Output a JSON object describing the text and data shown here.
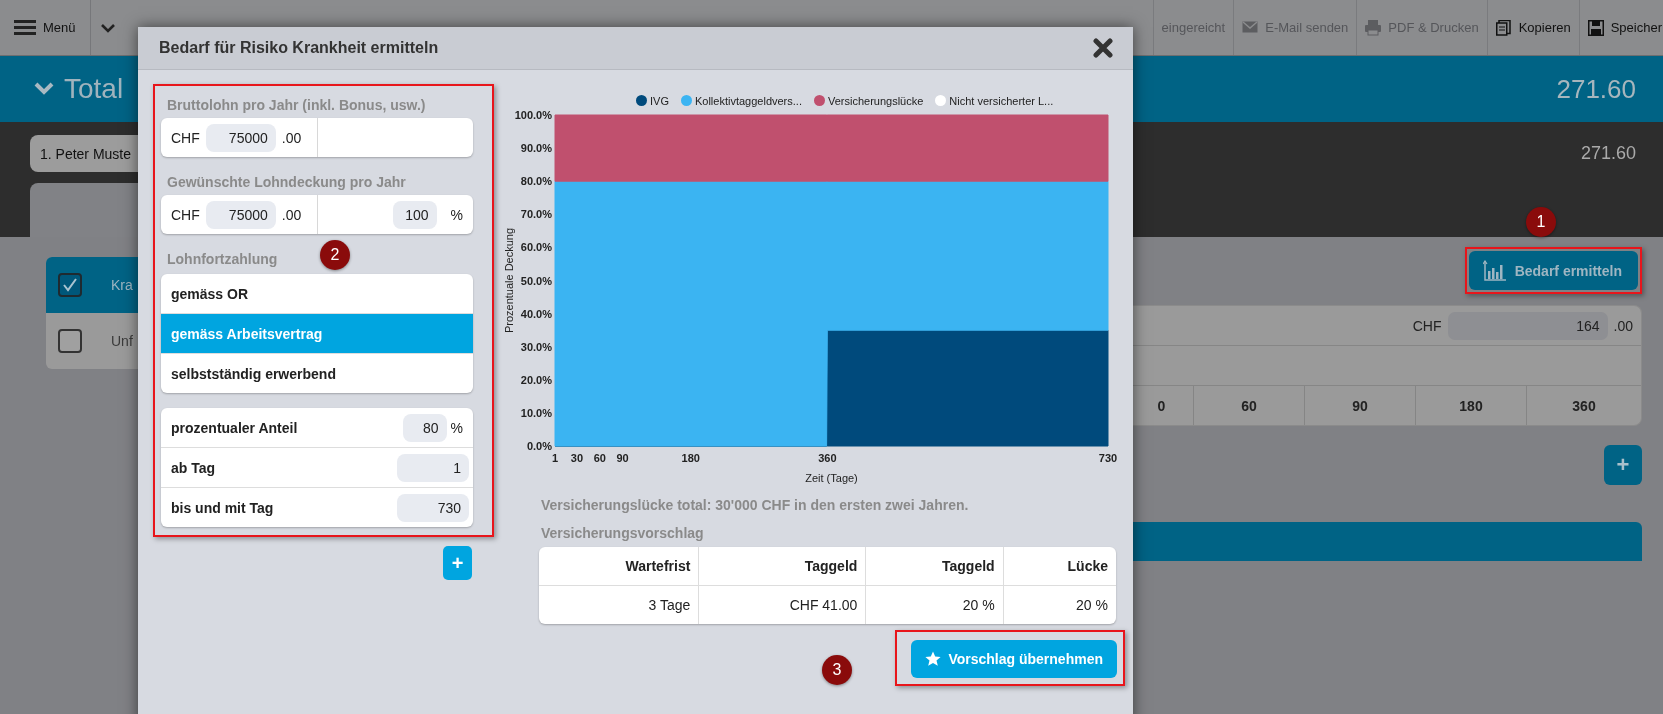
{
  "toolbar": {
    "menu_label": "Menü",
    "items": [
      {
        "label": "eingereicht",
        "disabled": true
      },
      {
        "label": "E-Mail senden",
        "kind": "mail",
        "disabled": true
      },
      {
        "label": "PDF & Drucken",
        "kind": "print",
        "disabled": true
      },
      {
        "label": "Kopieren",
        "kind": "copy",
        "disabled": false
      },
      {
        "label": "Speicher",
        "kind": "save",
        "disabled": false
      }
    ]
  },
  "background": {
    "total_title": "Total",
    "total_amount": "271.60",
    "person": "1. Peter Muste",
    "person_amount": "271.60",
    "risks": [
      {
        "label": "Kra",
        "checked": true
      },
      {
        "label": "Unf",
        "checked": false
      }
    ],
    "needs_button": "Bedarf ermitteln",
    "premium": {
      "currency": "CHF",
      "value": "164",
      "decimals": ".00"
    },
    "waiting_days": [
      "0",
      "60",
      "90",
      "180",
      "360"
    ],
    "add_button": "+"
  },
  "dialog": {
    "title": "Bedarf für Risiko Krankheit ermitteln",
    "gross_salary": {
      "label": "Bruttolohn pro Jahr (inkl. Bonus, usw.)",
      "currency": "CHF",
      "value": "75000",
      "decimals": ".00"
    },
    "coverage": {
      "label": "Gewünschte Lohndeckung pro Jahr",
      "currency": "CHF",
      "value": "75000",
      "decimals": ".00",
      "percent": "100",
      "unit": "%"
    },
    "continuation": {
      "label": "Lohnfortzahlung",
      "options": [
        {
          "label": "gemäss OR",
          "selected": false
        },
        {
          "label": "gemäss Arbeitsvertrag",
          "selected": true
        },
        {
          "label": "selbstständig erwerbend",
          "selected": false
        }
      ]
    },
    "parameters": [
      {
        "label": "prozentualer Anteil",
        "value": "80",
        "unit": "%"
      },
      {
        "label": "ab Tag",
        "value": "1"
      },
      {
        "label": "bis und mit Tag",
        "value": "730"
      }
    ],
    "add_button": "+",
    "chart_data": {
      "type": "area",
      "stacked": true,
      "legend": "top",
      "xlabel": "Zeit (Tage)",
      "ylabel": "Prozentuale Deckung",
      "x": [
        1,
        359,
        360,
        730
      ],
      "series": [
        {
          "name": "IVG",
          "color": "#004a7c",
          "values": [
            0,
            0,
            35,
            35
          ]
        },
        {
          "name": "Kollektivtaggeldvers...",
          "color": "#3bb4f2",
          "values": [
            80,
            80,
            45,
            45
          ]
        },
        {
          "name": "Versicherungslücke",
          "color": "#c0506e",
          "values": [
            20,
            20,
            20,
            20
          ]
        },
        {
          "name": "Nicht versicherter L...",
          "color": "#ffffff",
          "values": [
            null,
            null,
            null,
            null
          ]
        }
      ],
      "xlim": [
        1,
        730
      ],
      "ylim": [
        0,
        100
      ],
      "xticks": [
        1,
        30,
        60,
        90,
        180,
        360,
        730
      ],
      "yticks": [
        {
          "value": 0,
          "label": "0.0%"
        },
        {
          "value": 10,
          "label": "10.0%"
        },
        {
          "value": 20,
          "label": "20.0%"
        },
        {
          "value": 30,
          "label": "30.0%"
        },
        {
          "value": 40,
          "label": "40.0%"
        },
        {
          "value": 50,
          "label": "50.0%"
        },
        {
          "value": 60,
          "label": "60.0%"
        },
        {
          "value": 70,
          "label": "70.0%"
        },
        {
          "value": 80,
          "label": "80.0%"
        },
        {
          "value": 90,
          "label": "90.0%"
        },
        {
          "value": 100,
          "label": "100.0%"
        }
      ]
    },
    "gap_summary": "Versicherungslücke total: 30'000 CHF in den ersten zwei Jahren.",
    "proposal": {
      "title": "Versicherungsvorschlag",
      "columns": [
        "Wartefrist",
        "Taggeld",
        "Taggeld",
        "Lücke"
      ],
      "rows": [
        [
          "3 Tage",
          "CHF 41.00",
          "20 %",
          "20 %"
        ]
      ]
    },
    "accept_button": "Vorschlag übernehmen"
  },
  "annotations": [
    {
      "number": "1"
    },
    {
      "number": "2"
    },
    {
      "number": "3"
    }
  ]
}
